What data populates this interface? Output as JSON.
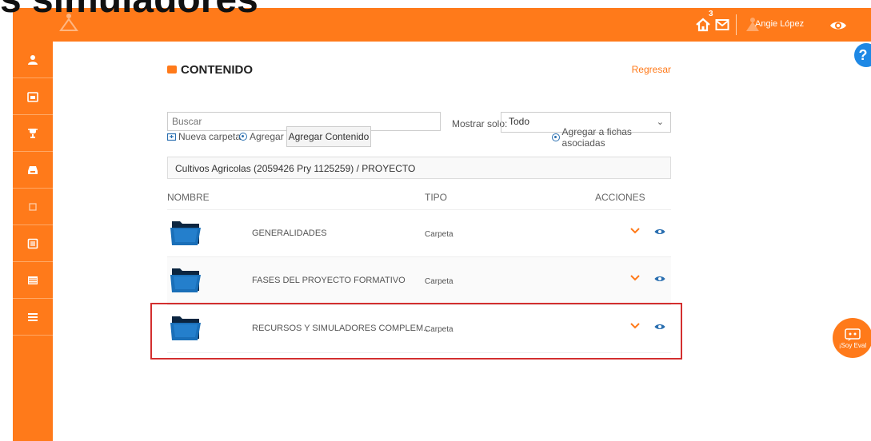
{
  "overlay_title": "s simuladores",
  "topbar": {
    "notifications_count": "3",
    "user_name": "Angie López"
  },
  "sidebar": {
    "items": [
      {
        "icon": "user-icon"
      },
      {
        "icon": "calendar-icon"
      },
      {
        "icon": "trophy-icon"
      },
      {
        "icon": "inbox-icon"
      },
      {
        "icon": "square-icon"
      },
      {
        "icon": "document-icon"
      },
      {
        "icon": "list-icon"
      },
      {
        "icon": "menu-icon"
      }
    ]
  },
  "help_label": "?",
  "eval_label": "¡Soy Eval",
  "content": {
    "title": "CONTENIDO",
    "back_link": "Regresar",
    "search_placeholder": "Buscar",
    "show_only_label": "Mostrar solo:",
    "show_only_value": "Todo",
    "new_folder_label": "Nueva carpeta",
    "add_label": "Agregar",
    "add_content_button": "Agregar Contenido",
    "add_to_sheets_label": "Agregar a fichas asociadas",
    "path": "Cultivos Agricolas (2059426 Pry 1125259) / PROYECTO",
    "columns": {
      "name": "NOMBRE",
      "type": "TIPO",
      "actions": "ACCIONES"
    },
    "rows": [
      {
        "name": "GENERALIDADES",
        "type": "Carpeta"
      },
      {
        "name": "FASES DEL PROYECTO FORMATIVO",
        "type": "Carpeta"
      },
      {
        "name": "RECURSOS Y SIMULADORES COMPLEM...",
        "type": "Carpeta"
      }
    ]
  },
  "colors": {
    "accent": "#ff7a1a",
    "highlight": "#d32f2f",
    "help": "#1e88e5"
  }
}
